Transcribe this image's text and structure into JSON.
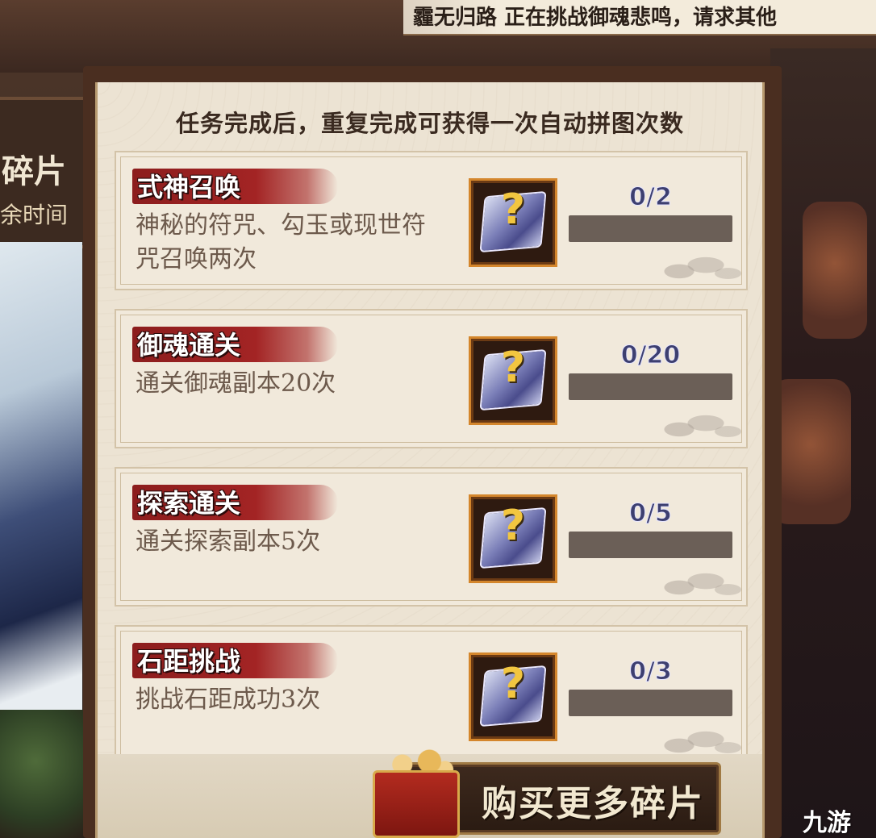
{
  "marquee": {
    "text": "霾无归路 正在挑战御魂悲鸣，请求其他"
  },
  "left_panel": {
    "title": "碎片",
    "subtitle": "余时间"
  },
  "header": {
    "note": "任务完成后，重复完成可获得一次自动拼图次数"
  },
  "tasks": [
    {
      "title": "式神召唤",
      "desc": "神秘的符咒、勾玉或现世符咒召唤两次",
      "progress": "0/2",
      "fraction": 0,
      "reward_icon": "mystery-scroll-icon"
    },
    {
      "title": "御魂通关",
      "desc": "通关御魂副本20次",
      "progress": "0/20",
      "fraction": 0,
      "reward_icon": "mystery-scroll-icon"
    },
    {
      "title": "探索通关",
      "desc": "通关探索副本5次",
      "progress": "0/5",
      "fraction": 0,
      "reward_icon": "mystery-scroll-icon"
    },
    {
      "title": "石距挑战",
      "desc": "挑战石距成功3次",
      "progress": "0/3",
      "fraction": 0,
      "reward_icon": "mystery-scroll-icon"
    }
  ],
  "buy_button": {
    "label": "购买更多碎片",
    "icon": "puzzle-gift-icon"
  },
  "watermark": {
    "text": "九游"
  }
}
